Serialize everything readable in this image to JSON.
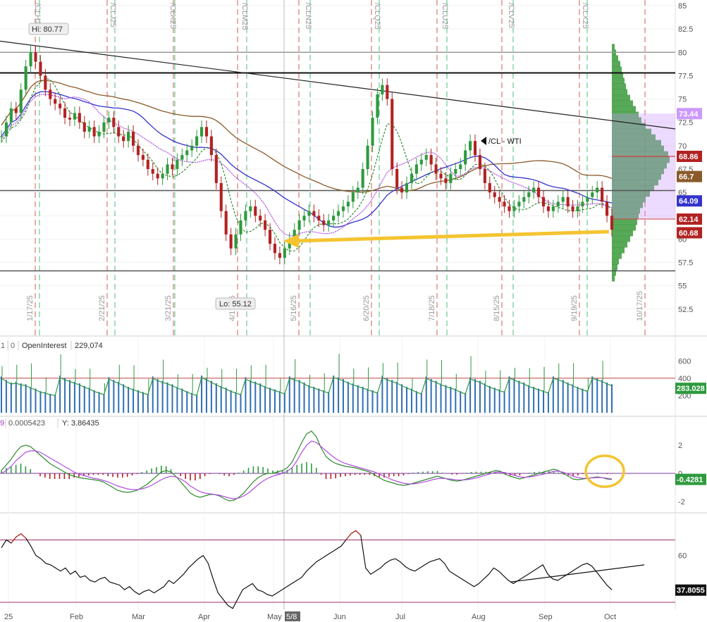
{
  "chart_data": {
    "type": "candlestick",
    "symbol_label": "/CL - WTI",
    "main_panel": {
      "y_range": [
        50,
        85
      ],
      "y_ticks": [
        85,
        82.5,
        80,
        77.5,
        75,
        72.5,
        70,
        67.5,
        65,
        62.5,
        60,
        57.5,
        55,
        52.5
      ],
      "hi_label": "Hi: 80.77",
      "lo_label": "Lo: 55.12",
      "price_badges": [
        {
          "label": "73.44",
          "value": 73.44,
          "bg": "#cc99ff"
        },
        {
          "label": "68.86",
          "value": 68.86,
          "bg": "#b22222"
        },
        {
          "label": "66.7",
          "value": 66.7,
          "bg": "#8b5a2b"
        },
        {
          "label": "64.09",
          "value": 64.09,
          "bg": "#3333cc"
        },
        {
          "label": "62.14",
          "value": 62.14,
          "bg": "#b22222"
        },
        {
          "label": "60.68",
          "value": 60.68,
          "bg": "#b22222"
        }
      ],
      "horizontal_lines": [
        80,
        77.8,
        65.2,
        56.6
      ],
      "contract_labels": [
        "/CLH25",
        "/CLJ25",
        "/CLK25",
        "/CLM25",
        "/CLN25",
        "/CLQ25",
        "/CLU25",
        "/CLV25",
        "/CLX25"
      ],
      "expiry_dates": [
        "1/17/25",
        "2/21/25",
        "3/21/25",
        "4/17/25",
        "5/16/25",
        "6/20/25",
        "7/18/25",
        "8/15/25",
        "9/19/25",
        "10/17/25"
      ],
      "closes": [
        71.0,
        72.5,
        74.0,
        73.5,
        76.0,
        78.5,
        80.0,
        79.0,
        77.5,
        76.0,
        75.0,
        74.5,
        74.0,
        73.0,
        72.8,
        73.5,
        72.5,
        71.5,
        72.0,
        71.0,
        71.5,
        72.5,
        73.0,
        72.0,
        71.0,
        70.5,
        71.5,
        70.0,
        69.0,
        68.5,
        67.5,
        67.0,
        66.5,
        67.0,
        68.0,
        67.5,
        68.5,
        69.0,
        69.5,
        70.0,
        71.0,
        72.0,
        71.0,
        69.0,
        66.0,
        63.0,
        60.5,
        59.0,
        60.5,
        62.0,
        63.0,
        63.5,
        62.5,
        62.0,
        61.0,
        59.5,
        58.5,
        58.0,
        59.0,
        60.0,
        61.0,
        62.0,
        62.5,
        63.0,
        62.5,
        62.0,
        61.5,
        62.0,
        62.5,
        63.0,
        63.5,
        64.0,
        65.0,
        65.5,
        67.5,
        70.0,
        73.0,
        75.5,
        76.5,
        75.0,
        67.5,
        65.5,
        65.0,
        66.0,
        67.0,
        68.0,
        68.5,
        69.0,
        68.0,
        67.0,
        66.5,
        66.0,
        67.0,
        67.5,
        68.0,
        69.5,
        70.5,
        69.0,
        67.5,
        66.0,
        65.0,
        64.5,
        64.0,
        63.5,
        63.0,
        63.5,
        64.0,
        64.5,
        65.0,
        65.5,
        64.5,
        63.5,
        63.0,
        63.5,
        64.0,
        64.5,
        63.5,
        63.0,
        63.5,
        64.0,
        64.5,
        65.0,
        65.5,
        64.0,
        62.5,
        61.0
      ]
    },
    "volume_panel": {
      "y_range": [
        0,
        700
      ],
      "y_ticks": [
        600,
        400,
        200
      ],
      "legend": [
        {
          "label": "1",
          "color": "#666"
        },
        {
          "label": "0",
          "color": "#666"
        },
        {
          "label": "OpenInterest",
          "color": "#333"
        },
        {
          "label": "229,074",
          "color": "#333"
        }
      ],
      "value_badge": "283.028",
      "values": [
        420,
        380,
        350,
        360,
        340,
        330,
        300,
        280,
        250,
        240,
        220,
        210,
        430,
        400,
        380,
        360,
        340,
        310,
        290,
        260,
        240,
        220,
        410,
        380,
        360,
        330,
        300,
        280,
        260,
        240,
        220,
        420,
        390,
        370,
        350,
        330,
        300,
        280,
        250,
        230,
        210,
        430,
        400,
        370,
        340,
        310,
        290,
        260,
        240,
        220,
        410,
        380,
        360,
        340,
        310,
        290,
        270,
        250,
        230,
        420,
        400,
        380,
        350,
        320,
        300,
        280,
        260,
        240,
        430,
        410,
        390,
        360,
        340,
        320,
        300,
        280,
        260,
        240,
        430,
        400,
        380,
        360,
        330,
        300,
        280,
        250,
        230,
        420,
        390,
        370,
        340,
        320,
        300,
        280,
        250,
        230,
        410,
        390,
        370,
        340,
        310,
        290,
        270,
        250,
        420,
        400,
        370,
        350,
        320,
        300,
        280,
        260,
        240,
        420,
        400,
        380,
        350,
        330,
        300,
        280,
        260,
        420,
        400,
        380,
        350,
        330
      ]
    },
    "macd_panel": {
      "y_range": [
        -2.5,
        3.0
      ],
      "y_ticks": [
        2,
        0,
        -2
      ],
      "legend": [
        {
          "label": "0.0005423",
          "color": "#555"
        },
        {
          "label": "Y: 3.86435",
          "color": "#333"
        }
      ],
      "value_badge": "-0.4281",
      "macd": [
        0.2,
        0.6,
        1.0,
        1.5,
        1.9,
        2.0,
        1.9,
        1.6,
        1.3,
        1.0,
        0.7,
        0.5,
        0.3,
        0.1,
        -0.1,
        -0.2,
        -0.3,
        -0.35,
        -0.4,
        -0.45,
        -0.5,
        -0.6,
        -0.8,
        -1.0,
        -1.2,
        -1.3,
        -1.35,
        -1.3,
        -1.2,
        -1.0,
        -0.8,
        -0.5,
        -0.2,
        0.1,
        0.2,
        0.1,
        -0.2,
        -0.6,
        -1.0,
        -1.4,
        -1.6,
        -1.7,
        -1.6,
        -1.5,
        -1.5,
        -1.6,
        -1.8,
        -1.95,
        -1.9,
        -1.7,
        -1.4,
        -1.0,
        -0.6,
        -0.3,
        -0.1,
        0.0,
        0.0,
        0.1,
        0.2,
        0.4,
        0.8,
        1.5,
        2.2,
        2.8,
        3.0,
        2.6,
        1.8,
        1.2,
        0.9,
        0.7,
        0.6,
        0.5,
        0.45,
        0.4,
        0.3,
        0.2,
        0.1,
        -0.1,
        -0.3,
        -0.5,
        -0.6,
        -0.7,
        -0.8,
        -0.85,
        -0.8,
        -0.7,
        -0.6,
        -0.5,
        -0.4,
        -0.3,
        -0.2,
        -0.3,
        -0.4,
        -0.5,
        -0.55,
        -0.5,
        -0.4,
        -0.3,
        -0.2,
        -0.1,
        0.0,
        0.1,
        0.2,
        0.15,
        -0.05,
        -0.2,
        -0.3,
        -0.4,
        -0.3,
        -0.2,
        -0.1,
        0.0,
        0.1,
        0.2,
        0.3,
        0.2,
        0.0,
        -0.2,
        -0.4,
        -0.45,
        -0.4,
        -0.35,
        -0.3,
        -0.25,
        -0.3,
        -0.4,
        -0.43
      ],
      "signal": [
        0.0,
        0.2,
        0.5,
        0.9,
        1.2,
        1.5,
        1.6,
        1.6,
        1.5,
        1.3,
        1.1,
        0.9,
        0.7,
        0.5,
        0.3,
        0.1,
        -0.05,
        -0.15,
        -0.25,
        -0.35,
        -0.4,
        -0.5,
        -0.6,
        -0.75,
        -0.9,
        -1.0,
        -1.1,
        -1.15,
        -1.15,
        -1.1,
        -1.0,
        -0.85,
        -0.65,
        -0.45,
        -0.3,
        -0.2,
        -0.25,
        -0.4,
        -0.6,
        -0.9,
        -1.1,
        -1.3,
        -1.4,
        -1.45,
        -1.5,
        -1.55,
        -1.65,
        -1.75,
        -1.8,
        -1.75,
        -1.6,
        -1.4,
        -1.1,
        -0.8,
        -0.55,
        -0.35,
        -0.2,
        -0.1,
        0.0,
        0.15,
        0.4,
        0.9,
        1.5,
        2.0,
        2.3,
        2.2,
        1.9,
        1.6,
        1.3,
        1.05,
        0.85,
        0.7,
        0.6,
        0.5,
        0.4,
        0.3,
        0.2,
        0.1,
        -0.05,
        -0.2,
        -0.35,
        -0.5,
        -0.6,
        -0.7,
        -0.75,
        -0.75,
        -0.7,
        -0.62,
        -0.55,
        -0.45,
        -0.38,
        -0.35,
        -0.38,
        -0.42,
        -0.46,
        -0.47,
        -0.45,
        -0.4,
        -0.32,
        -0.22,
        -0.12,
        -0.02,
        0.08,
        0.1,
        0.05,
        -0.05,
        -0.15,
        -0.25,
        -0.28,
        -0.25,
        -0.2,
        -0.12,
        -0.05,
        0.05,
        0.15,
        0.15,
        0.08,
        -0.05,
        -0.2,
        -0.3,
        -0.35,
        -0.35,
        -0.32,
        -0.3,
        -0.3,
        -0.35,
        -0.4
      ]
    },
    "rsi_panel": {
      "y_range": [
        25,
        82
      ],
      "y_ticks": [
        60
      ],
      "value_badge": "37.8055",
      "overbought": 70,
      "oversold": 30,
      "values": [
        65,
        70,
        68,
        72,
        74,
        71,
        66,
        60,
        58,
        55,
        54,
        52,
        50,
        52,
        48,
        50,
        46,
        47,
        44,
        43,
        45,
        46,
        43,
        42,
        41,
        38,
        40,
        37,
        35,
        37,
        38,
        36,
        38,
        40,
        44,
        42,
        45,
        48,
        52,
        55,
        58,
        60,
        55,
        45,
        36,
        32,
        28,
        26,
        32,
        38,
        40,
        42,
        38,
        37,
        35,
        34,
        36,
        38,
        40,
        42,
        44,
        46,
        50,
        53,
        56,
        58,
        60,
        62,
        64,
        66,
        70,
        74,
        76,
        73,
        52,
        48,
        50,
        52,
        55,
        57,
        58,
        56,
        53,
        51,
        50,
        52,
        54,
        56,
        57,
        58,
        55,
        50,
        48,
        46,
        44,
        42,
        40,
        42,
        45,
        48,
        52,
        50,
        47,
        44,
        42,
        44,
        46,
        48,
        50,
        52,
        54,
        48,
        45,
        44,
        46,
        48,
        50,
        52,
        54,
        55,
        53,
        49,
        45,
        41,
        38
      ],
      "trendline_label": ""
    },
    "x_axis": {
      "labels": [
        "25",
        "Feb",
        "Mar",
        "Apr",
        "May",
        "5/8",
        "Jun",
        "Jul",
        "Aug",
        "Sep",
        "Oct"
      ],
      "highlighted": "5/8"
    }
  }
}
